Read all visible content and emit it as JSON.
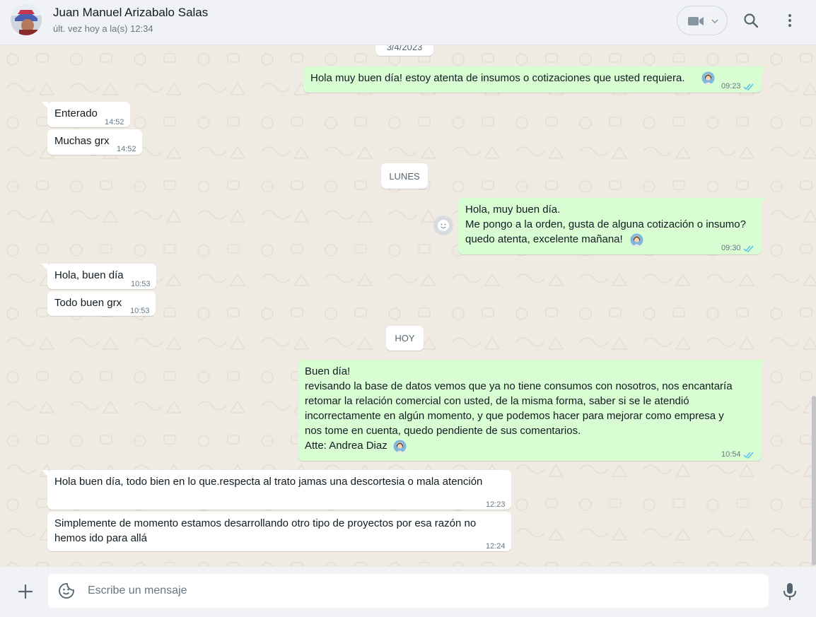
{
  "header": {
    "contact_name": "Juan Manuel Arizabalo Salas",
    "status": "últ. vez hoy a la(s) 12:34"
  },
  "chat": {
    "date_partial": "3/4/2023",
    "messages": [
      {
        "dir": "out",
        "text": "Hola muy buen día! estoy atenta de insumos o cotizaciones que usted requiera.",
        "time": "09:23"
      },
      {
        "dir": "in",
        "text": "Enterado",
        "time": "14:52"
      },
      {
        "dir": "in",
        "text": "Muchas grx",
        "time": "14:52"
      },
      {
        "dir": "out",
        "text": "Hola, muy buen día.\nMe pongo a la orden, gusta de alguna cotización o insumo?\nquedo atenta, excelente mañana!",
        "time": "09:30"
      },
      {
        "dir": "in",
        "text": "Hola, buen día",
        "time": "10:53"
      },
      {
        "dir": "in",
        "text": "Todo buen grx",
        "time": "10:53"
      },
      {
        "dir": "out",
        "text": "Buen día!\nrevisando la base de datos vemos que ya no tiene consumos con nosotros, nos encantaría\nretomar la relación comercial con usted, de la misma forma, saber si se le atendió\nincorrectamente en algún momento, y que podemos hacer para mejorar como empresa y\nnos tome en cuenta, quedo pendiente de sus comentarios.\nAtte: Andrea Diaz",
        "time": "10:54"
      },
      {
        "dir": "in",
        "text": "Hola buen día, todo bien en lo que.respecta al trato jamas una descortesia o mala atención",
        "time": "12:23"
      },
      {
        "dir": "in",
        "text": "Simplemente de momento estamos desarrollando otro tipo de proyectos por esa razón no\nhemos ido para allá",
        "time": "12:24"
      }
    ],
    "separators": [
      "LUNES",
      "HOY"
    ]
  },
  "footer": {
    "placeholder": "Escribe un mensaje"
  },
  "colors": {
    "outgoing_bubble": "#d9fdd3",
    "incoming_bubble": "#ffffff",
    "read_ticks": "#53bdeb",
    "chat_background": "#efeae2"
  },
  "icons": [
    "avatar",
    "video-call-icon",
    "chevron-down-icon",
    "search-icon",
    "menu-icon",
    "woman-emoji",
    "double-check-icon",
    "emoji-reaction-icon",
    "plus-icon",
    "sticker-icon",
    "mic-icon"
  ]
}
